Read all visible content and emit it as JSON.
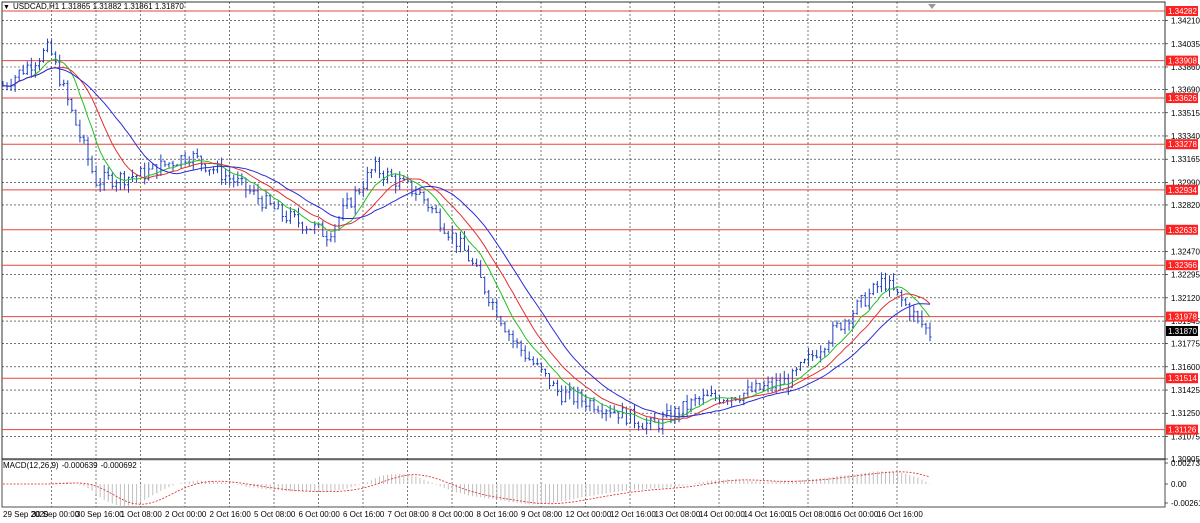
{
  "header": {
    "symbol": "USDCAD,H1",
    "open": "1.31865",
    "high": "1.31882",
    "low": "1.31861",
    "close": "1.31870"
  },
  "macd": {
    "label": "MACD(12,26,9)",
    "main": "-0.000639",
    "signal": "-0.000692",
    "axis_labels": [
      "0.002739",
      "0.00",
      "-0.002612"
    ]
  },
  "price_axis": {
    "labels": [
      "1.34210",
      "1.34035",
      "1.33860",
      "1.33690",
      "1.33515",
      "1.33340",
      "1.33165",
      "1.32990",
      "1.32820",
      "1.32470",
      "1.32295",
      "1.32120",
      "1.31945",
      "1.31775",
      "1.31600",
      "1.31425",
      "1.31250",
      "1.31075",
      "1.30905"
    ],
    "current_price": "1.31870"
  },
  "levels": [
    "1.34282",
    "1.33908",
    "1.33626",
    "1.33278",
    "1.32934",
    "1.32633",
    "1.32366",
    "1.31978",
    "1.31514",
    "1.31126"
  ],
  "time_axis": [
    "29 Sep 2020",
    "30 Sep 00:00",
    "30 Sep 16:00",
    "1 Oct 08:00",
    "2 Oct 00:00",
    "2 Oct 16:00",
    "5 Oct 08:00",
    "6 Oct 00:00",
    "6 Oct 16:00",
    "7 Oct 08:00",
    "8 Oct 00:00",
    "8 Oct 16:00",
    "9 Oct 08:00",
    "12 Oct 00:00",
    "12 Oct 16:00",
    "13 Oct 08:00",
    "14 Oct 00:00",
    "14 Oct 16:00",
    "15 Oct 08:00",
    "16 Oct 00:00",
    "16 Oct 16:00"
  ],
  "colors": {
    "candles": "#1f3fbf",
    "level_line": "#e8453c",
    "level_tag": "#ff2020",
    "ma_fast": "#22c022",
    "ma_mid": "#e03030",
    "ma_slow": "#2a2ad8",
    "macd_hist": "#c0c0c0",
    "macd_signal": "#e02020",
    "grid": "#222222"
  },
  "chart_data": {
    "type": "line",
    "description_series": "USDCAD H1 close path (approximate)",
    "x": [
      "29 Sep 2020",
      "30 Sep 00:00",
      "30 Sep 16:00",
      "1 Oct 08:00",
      "2 Oct 00:00",
      "2 Oct 16:00",
      "5 Oct 08:00",
      "6 Oct 00:00",
      "6 Oct 16:00",
      "7 Oct 08:00",
      "8 Oct 00:00",
      "8 Oct 16:00",
      "9 Oct 08:00",
      "12 Oct 00:00",
      "12 Oct 16:00",
      "13 Oct 08:00",
      "14 Oct 00:00",
      "14 Oct 16:00",
      "15 Oct 08:00",
      "16 Oct 00:00",
      "16 Oct 16:00"
    ],
    "series": [
      {
        "values": [
          1.3372,
          1.34,
          1.33,
          1.3305,
          1.332,
          1.33,
          1.3275,
          1.326,
          1.331,
          1.329,
          1.3245,
          1.318,
          1.314,
          1.313,
          1.3115,
          1.3135,
          1.314,
          1.315,
          1.319,
          1.3225,
          1.3185
        ]
      }
    ],
    "ylim": [
      1.30905,
      1.3435
    ]
  }
}
